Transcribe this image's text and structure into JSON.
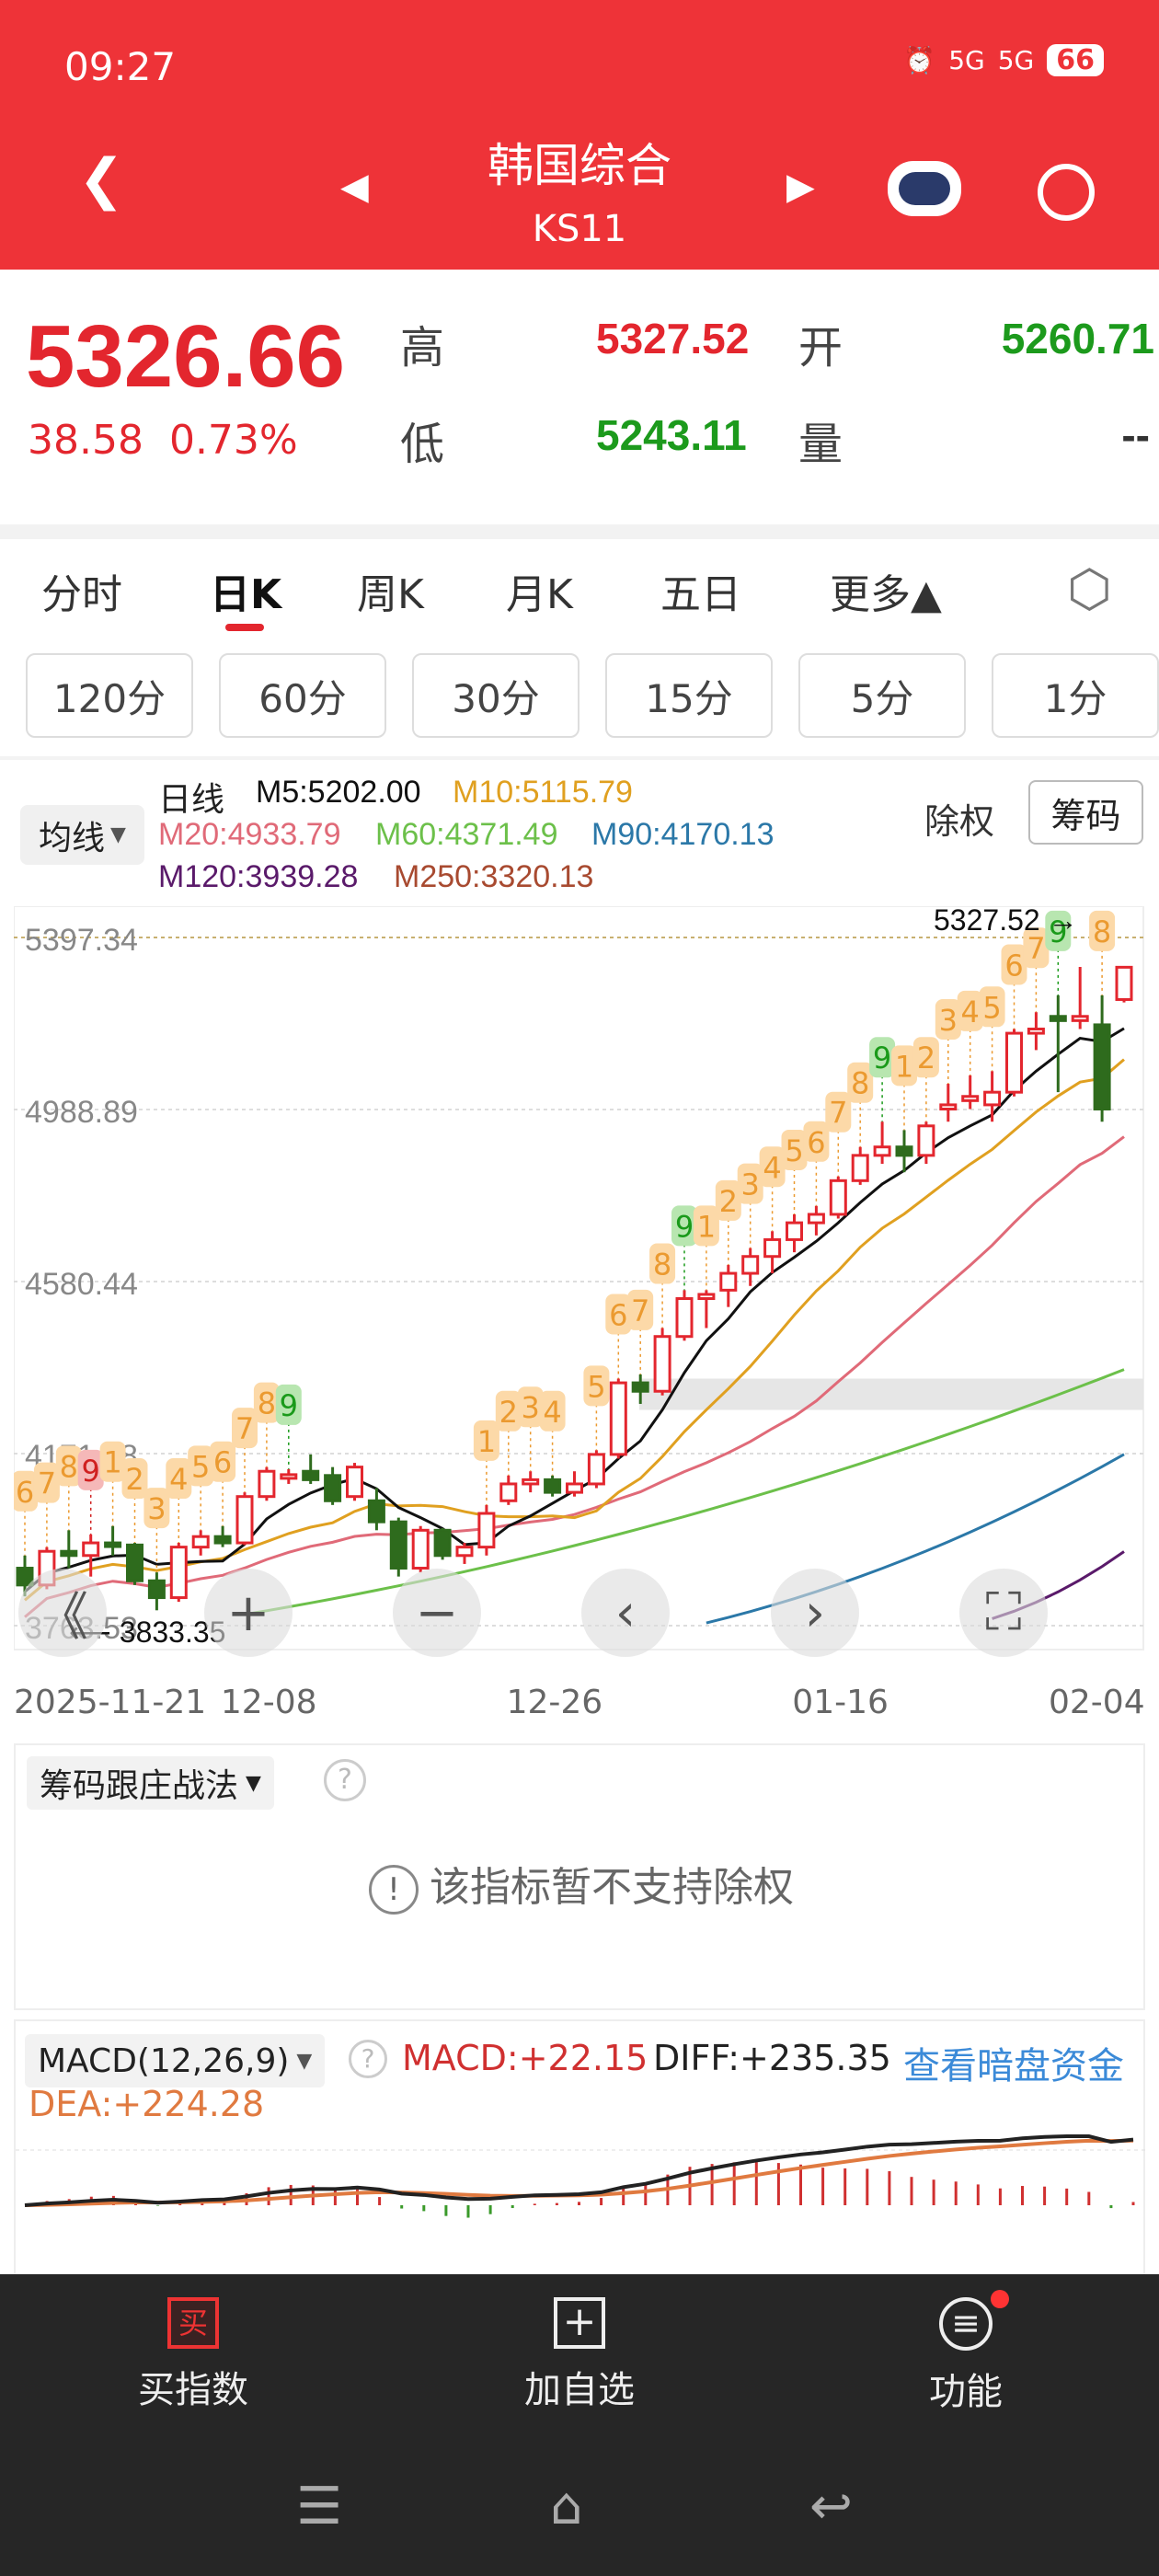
{
  "status": {
    "time": "09:27",
    "signal1": "5G",
    "signal2": "5G",
    "battery": "66"
  },
  "header": {
    "title": "韩国综合",
    "code": "KS11"
  },
  "quote": {
    "price": "5326.66",
    "change": "38.58",
    "change_pct": "0.73%",
    "high_label": "高",
    "high": "5327.52",
    "open_label": "开",
    "open": "5260.71",
    "low_label": "低",
    "low": "5243.11",
    "vol_label": "量",
    "vol": "--"
  },
  "tabs": [
    "分时",
    "日K",
    "周K",
    "月K",
    "五日",
    "更多▲"
  ],
  "minutes": [
    "120分",
    "60分",
    "30分",
    "15分",
    "5分",
    "1分"
  ],
  "ma": {
    "selector": "均线",
    "type": "日线",
    "m5": "M5:5202.00",
    "m10": "M10:5115.79",
    "m20": "M20:4933.79",
    "m60": "M60:4371.49",
    "m90": "M90:4170.13",
    "m120": "M120:3939.28",
    "m250": "M250:3320.13",
    "exright": "除权",
    "chips": "筹码"
  },
  "colors": {
    "up": "#e3262e",
    "down": "#2e6b1d",
    "m5": "#111111",
    "m10": "#e0a020",
    "m20": "#e06a78",
    "m60": "#6cc04a",
    "m90": "#2b78a8",
    "m120": "#5a1a6a"
  },
  "chart_data": {
    "type": "candlestick",
    "y_ticks": [
      "5397.34",
      "4988.89",
      "4580.44",
      "4171.98",
      "3763.53"
    ],
    "ylim": [
      3763.53,
      5397.34
    ],
    "max_label": "5327.52",
    "min_label": "3833.35",
    "x_labels": [
      {
        "i": 0,
        "t": "2025-11-21"
      },
      {
        "i": 11,
        "t": "12-08"
      },
      {
        "i": 24,
        "t": "12-26"
      },
      {
        "i": 37,
        "t": "01-16"
      },
      {
        "i": 50,
        "t": "02-04"
      }
    ],
    "ohlc": [
      [
        3900,
        3930,
        3833,
        3860
      ],
      [
        3860,
        3950,
        3850,
        3940
      ],
      [
        3940,
        3990,
        3900,
        3930
      ],
      [
        3930,
        3980,
        3880,
        3960
      ],
      [
        3960,
        4000,
        3930,
        3955
      ],
      [
        3955,
        3960,
        3860,
        3870
      ],
      [
        3870,
        3890,
        3800,
        3830
      ],
      [
        3830,
        3960,
        3820,
        3950
      ],
      [
        3950,
        3990,
        3930,
        3975
      ],
      [
        3975,
        4000,
        3950,
        3960
      ],
      [
        3960,
        4080,
        3955,
        4070
      ],
      [
        4070,
        4140,
        4060,
        4130
      ],
      [
        4120,
        4135,
        4100,
        4122
      ],
      [
        4130,
        4170,
        4100,
        4110
      ],
      [
        4120,
        4140,
        4050,
        4060
      ],
      [
        4070,
        4150,
        4060,
        4140
      ],
      [
        4060,
        4090,
        3990,
        4010
      ],
      [
        4010,
        4020,
        3880,
        3900
      ],
      [
        3900,
        4000,
        3890,
        3990
      ],
      [
        3990,
        3995,
        3920,
        3930
      ],
      [
        3930,
        3960,
        3910,
        3950
      ],
      [
        3950,
        4050,
        3930,
        4030
      ],
      [
        4060,
        4120,
        4050,
        4100
      ],
      [
        4100,
        4130,
        4080,
        4110
      ],
      [
        4110,
        4120,
        4070,
        4080
      ],
      [
        4080,
        4130,
        4070,
        4100
      ],
      [
        4100,
        4180,
        4090,
        4170
      ],
      [
        4170,
        4350,
        4160,
        4340
      ],
      [
        4340,
        4360,
        4290,
        4320
      ],
      [
        4320,
        4470,
        4310,
        4450
      ],
      [
        4450,
        4560,
        4440,
        4540
      ],
      [
        4540,
        4560,
        4470,
        4550
      ],
      [
        4560,
        4620,
        4520,
        4600
      ],
      [
        4600,
        4660,
        4570,
        4640
      ],
      [
        4640,
        4700,
        4600,
        4680
      ],
      [
        4680,
        4740,
        4650,
        4720
      ],
      [
        4720,
        4760,
        4690,
        4740
      ],
      [
        4740,
        4830,
        4730,
        4820
      ],
      [
        4820,
        4900,
        4810,
        4880
      ],
      [
        4880,
        4960,
        4860,
        4900
      ],
      [
        4900,
        4940,
        4840,
        4880
      ],
      [
        4880,
        4960,
        4860,
        4950
      ],
      [
        4990,
        5050,
        4960,
        5000
      ],
      [
        5010,
        5070,
        4990,
        5020
      ],
      [
        5000,
        5080,
        4960,
        5030
      ],
      [
        5030,
        5180,
        5020,
        5170
      ],
      [
        5170,
        5220,
        5130,
        5180
      ],
      [
        5210,
        5260,
        5030,
        5200
      ],
      [
        5200,
        5327.52,
        5180,
        5210
      ],
      [
        5190,
        5260,
        4960,
        4990
      ],
      [
        5250,
        5327.52,
        5243.11,
        5326.66
      ]
    ],
    "td_marks": [
      [
        0,
        "6",
        "o"
      ],
      [
        1,
        "7",
        "o"
      ],
      [
        2,
        "8",
        "o"
      ],
      [
        3,
        "9",
        "r"
      ],
      [
        4,
        "1",
        "o"
      ],
      [
        5,
        "2",
        "o"
      ],
      [
        6,
        "3",
        "o"
      ],
      [
        7,
        "4",
        "o"
      ],
      [
        8,
        "5",
        "o"
      ],
      [
        9,
        "6",
        "o"
      ],
      [
        10,
        "7",
        "o"
      ],
      [
        11,
        "8",
        "o"
      ],
      [
        12,
        "9",
        "g"
      ],
      [
        21,
        "1",
        "o"
      ],
      [
        22,
        "2",
        "o"
      ],
      [
        23,
        "3",
        "o"
      ],
      [
        24,
        "4",
        "o"
      ],
      [
        26,
        "5",
        "o"
      ],
      [
        27,
        "6",
        "o"
      ],
      [
        28,
        "7",
        "o"
      ],
      [
        29,
        "8",
        "o"
      ],
      [
        30,
        "9",
        "g"
      ],
      [
        31,
        "1",
        "o"
      ],
      [
        32,
        "2",
        "o"
      ],
      [
        33,
        "3",
        "o"
      ],
      [
        34,
        "4",
        "o"
      ],
      [
        35,
        "5",
        "o"
      ],
      [
        36,
        "6",
        "o"
      ],
      [
        37,
        "7",
        "o"
      ],
      [
        38,
        "8",
        "o"
      ],
      [
        39,
        "9",
        "g"
      ],
      [
        40,
        "1",
        "o"
      ],
      [
        41,
        "2",
        "o"
      ],
      [
        42,
        "3",
        "o"
      ],
      [
        43,
        "4",
        "o"
      ],
      [
        44,
        "5",
        "o"
      ],
      [
        45,
        "6",
        "o"
      ],
      [
        46,
        "7",
        "o"
      ],
      [
        47,
        "9",
        "g"
      ],
      [
        49,
        "8",
        "o"
      ]
    ],
    "ma_long": {
      "m60": [
        [
          10,
          3790
        ],
        [
          50,
          4371.49
        ]
      ],
      "m90": [
        [
          31,
          3770
        ],
        [
          50,
          4170.13
        ]
      ],
      "m120": [
        [
          44,
          3780
        ],
        [
          50,
          3939.28
        ]
      ]
    }
  },
  "controls": {
    "first": "《",
    "zoom_in": "+",
    "zoom_out": "−",
    "prev": "‹",
    "next": "›",
    "fullscreen": "⛶"
  },
  "strategy": {
    "selector": "筹码跟庄战法",
    "notice": "该指标暂不支持除权"
  },
  "macd": {
    "selector": "MACD(12,26,9)",
    "macd": "MACD:+22.15",
    "diff": "DIFF:+235.35",
    "dea": "DEA:+224.28",
    "link": "查看暗盘资金"
  },
  "bottom": {
    "buy": "买指数",
    "buy_icon": "买",
    "add": "加自选",
    "func": "功能"
  }
}
